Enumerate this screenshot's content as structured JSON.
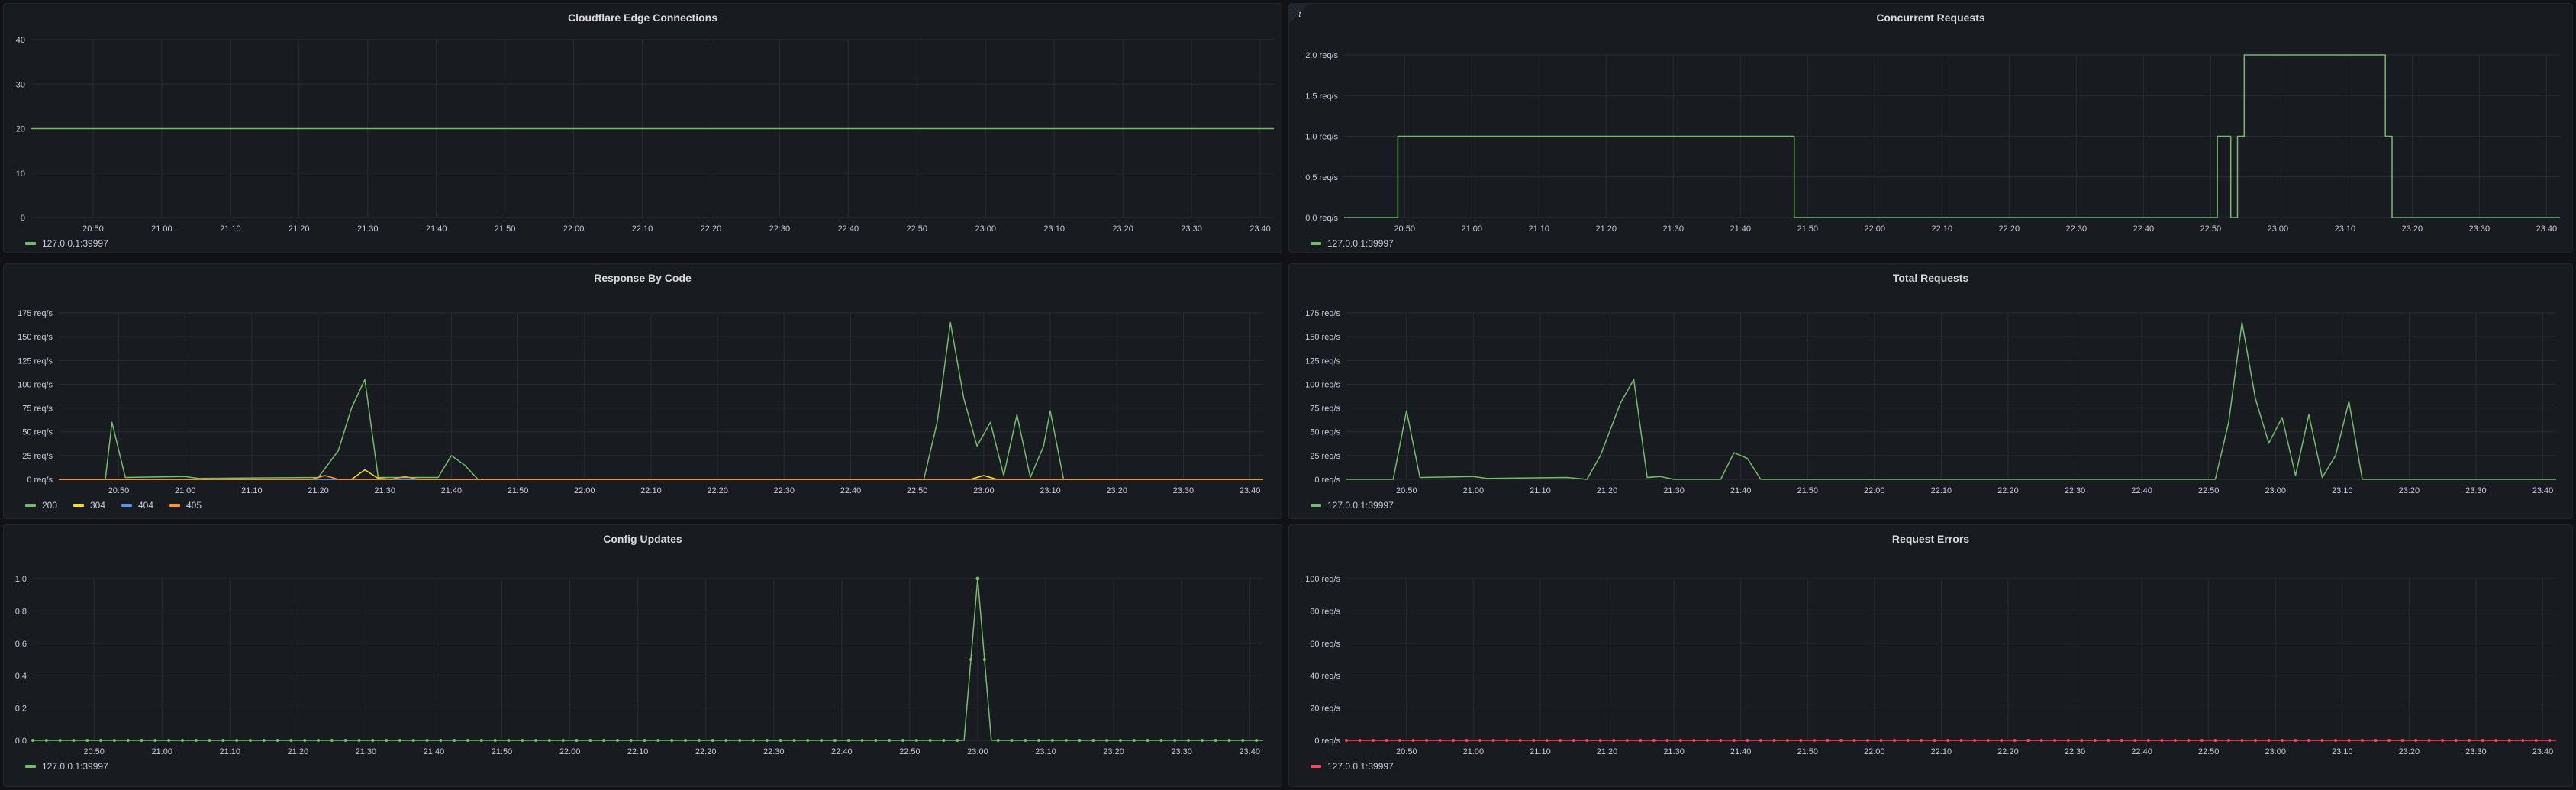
{
  "colors": {
    "green": "#73bf69",
    "yellow": "#fade2a",
    "blue": "#5794f2",
    "orange": "#ff9830",
    "red": "#f2495c"
  },
  "info_icon": "info-icon",
  "time_ticks": [
    "20:50",
    "21:00",
    "21:10",
    "21:20",
    "21:30",
    "21:40",
    "21:50",
    "22:00",
    "22:10",
    "22:20",
    "22:30",
    "22:40",
    "22:50",
    "23:00",
    "23:10",
    "23:20",
    "23:30",
    "23:40"
  ],
  "panels": [
    {
      "id": "cloudflare-edge-connections",
      "title": "Cloudflare Edge Connections",
      "y_ticks": [
        "0",
        "10",
        "20",
        "30",
        "40"
      ],
      "ylim": [
        0,
        40
      ],
      "legend": [
        {
          "label": "127.0.0.1:39997",
          "color": "#73bf69"
        }
      ]
    },
    {
      "id": "concurrent-requests",
      "title": "Concurrent Requests",
      "info": true,
      "y_ticks": [
        "0.0 req/s",
        "0.5 req/s",
        "1.0 req/s",
        "1.5 req/s",
        "2.0 req/s"
      ],
      "ylim": [
        0,
        2
      ],
      "legend": [
        {
          "label": "127.0.0.1:39997",
          "color": "#73bf69"
        }
      ]
    },
    {
      "id": "response-by-code",
      "title": "Response By Code",
      "y_ticks": [
        "0 req/s",
        "25 req/s",
        "50 req/s",
        "75 req/s",
        "100 req/s",
        "125 req/s",
        "150 req/s",
        "175 req/s"
      ],
      "ylim": [
        0,
        175
      ],
      "legend": [
        {
          "label": "200",
          "color": "#73bf69"
        },
        {
          "label": "304",
          "color": "#fade2a"
        },
        {
          "label": "404",
          "color": "#5794f2"
        },
        {
          "label": "405",
          "color": "#ff9830"
        }
      ]
    },
    {
      "id": "total-requests",
      "title": "Total Requests",
      "y_ticks": [
        "0 req/s",
        "25 req/s",
        "50 req/s",
        "75 req/s",
        "100 req/s",
        "125 req/s",
        "150 req/s",
        "175 req/s"
      ],
      "ylim": [
        0,
        175
      ],
      "legend": [
        {
          "label": "127.0.0.1:39997",
          "color": "#73bf69"
        }
      ]
    },
    {
      "id": "config-updates",
      "title": "Config Updates",
      "y_ticks": [
        "0.0",
        "0.2",
        "0.4",
        "0.6",
        "0.8",
        "1.0"
      ],
      "ylim": [
        0,
        1
      ],
      "legend": [
        {
          "label": "127.0.0.1:39997",
          "color": "#73bf69"
        }
      ]
    },
    {
      "id": "request-errors",
      "title": "Request Errors",
      "y_ticks": [
        "0 req/s",
        "20 req/s",
        "40 req/s",
        "60 req/s",
        "80 req/s",
        "100 req/s"
      ],
      "ylim": [
        0,
        100
      ],
      "legend": [
        {
          "label": "127.0.0.1:39997",
          "color": "#f2495c"
        }
      ]
    }
  ],
  "chart_data": [
    {
      "type": "line",
      "title": "Cloudflare Edge Connections",
      "x_range": [
        "20:41",
        "23:42"
      ],
      "ylim": [
        0,
        40
      ],
      "series": [
        {
          "name": "127.0.0.1:39997",
          "color": "#73bf69",
          "points": [
            [
              "20:41",
              20
            ],
            [
              "23:42",
              20
            ]
          ]
        }
      ]
    },
    {
      "type": "line",
      "title": "Concurrent Requests",
      "x_range": [
        "20:41",
        "23:42"
      ],
      "ylim": [
        0,
        2
      ],
      "series": [
        {
          "name": "127.0.0.1:39997",
          "color": "#73bf69",
          "points": [
            [
              "20:41",
              0
            ],
            [
              "20:49",
              0
            ],
            [
              "20:49",
              1
            ],
            [
              "21:48",
              1
            ],
            [
              "21:48",
              0
            ],
            [
              "22:51",
              0
            ],
            [
              "22:51",
              1
            ],
            [
              "22:53",
              1
            ],
            [
              "22:53",
              0
            ],
            [
              "22:54",
              0
            ],
            [
              "22:54",
              1
            ],
            [
              "22:55",
              1
            ],
            [
              "22:55",
              2
            ],
            [
              "23:16",
              2
            ],
            [
              "23:16",
              1
            ],
            [
              "23:17",
              1
            ],
            [
              "23:17",
              0
            ],
            [
              "23:42",
              0
            ]
          ]
        }
      ]
    },
    {
      "type": "line",
      "title": "Response By Code",
      "x_range": [
        "20:41",
        "23:42"
      ],
      "ylim": [
        0,
        175
      ],
      "series": [
        {
          "name": "200",
          "color": "#73bf69",
          "points": [
            [
              "20:41",
              0
            ],
            [
              "20:48",
              0
            ],
            [
              "20:49",
              60
            ],
            [
              "20:51",
              2
            ],
            [
              "21:00",
              3
            ],
            [
              "21:02",
              1
            ],
            [
              "21:20",
              2
            ],
            [
              "21:23",
              30
            ],
            [
              "21:25",
              75
            ],
            [
              "21:27",
              105
            ],
            [
              "21:29",
              2
            ],
            [
              "21:38",
              2
            ],
            [
              "21:40",
              25
            ],
            [
              "21:42",
              15
            ],
            [
              "21:44",
              0
            ],
            [
              "22:51",
              0
            ],
            [
              "22:53",
              60
            ],
            [
              "22:55",
              165
            ],
            [
              "22:57",
              85
            ],
            [
              "22:59",
              35
            ],
            [
              "23:01",
              60
            ],
            [
              "23:03",
              4
            ],
            [
              "23:05",
              68
            ],
            [
              "23:07",
              2
            ],
            [
              "23:09",
              35
            ],
            [
              "23:10",
              72
            ],
            [
              "23:12",
              0
            ],
            [
              "23:42",
              0
            ]
          ]
        },
        {
          "name": "304",
          "color": "#fade2a",
          "points": [
            [
              "20:41",
              0
            ],
            [
              "21:25",
              0
            ],
            [
              "21:27",
              10
            ],
            [
              "21:29",
              1
            ],
            [
              "21:31",
              0
            ],
            [
              "22:58",
              0
            ],
            [
              "23:00",
              4
            ],
            [
              "23:02",
              0
            ],
            [
              "23:42",
              0
            ]
          ]
        },
        {
          "name": "404",
          "color": "#5794f2",
          "points": [
            [
              "20:41",
              0
            ],
            [
              "23:42",
              0
            ]
          ]
        },
        {
          "name": "405",
          "color": "#ff9830",
          "points": [
            [
              "20:41",
              0
            ],
            [
              "21:19",
              0
            ],
            [
              "21:21",
              4
            ],
            [
              "21:23",
              0
            ],
            [
              "21:31",
              0
            ],
            [
              "21:33",
              3
            ],
            [
              "21:35",
              0
            ],
            [
              "23:42",
              0
            ]
          ]
        }
      ]
    },
    {
      "type": "line",
      "title": "Total Requests",
      "x_range": [
        "20:41",
        "23:42"
      ],
      "ylim": [
        0,
        175
      ],
      "series": [
        {
          "name": "127.0.0.1:39997",
          "color": "#73bf69",
          "points": [
            [
              "20:41",
              0
            ],
            [
              "20:48",
              0
            ],
            [
              "20:50",
              72
            ],
            [
              "20:52",
              2
            ],
            [
              "21:00",
              3
            ],
            [
              "21:02",
              1
            ],
            [
              "21:14",
              2
            ],
            [
              "21:17",
              0
            ],
            [
              "21:19",
              25
            ],
            [
              "21:22",
              80
            ],
            [
              "21:24",
              105
            ],
            [
              "21:26",
              2
            ],
            [
              "21:28",
              3
            ],
            [
              "21:30",
              0
            ],
            [
              "21:37",
              0
            ],
            [
              "21:39",
              28
            ],
            [
              "21:41",
              22
            ],
            [
              "21:43",
              0
            ],
            [
              "22:51",
              0
            ],
            [
              "22:53",
              60
            ],
            [
              "22:55",
              165
            ],
            [
              "22:57",
              85
            ],
            [
              "22:59",
              38
            ],
            [
              "23:01",
              65
            ],
            [
              "23:03",
              4
            ],
            [
              "23:05",
              68
            ],
            [
              "23:07",
              2
            ],
            [
              "23:09",
              25
            ],
            [
              "23:11",
              82
            ],
            [
              "23:13",
              0
            ],
            [
              "23:42",
              0
            ]
          ]
        }
      ]
    },
    {
      "type": "line",
      "title": "Config Updates",
      "x_range": [
        "20:41",
        "23:42"
      ],
      "ylim": [
        0,
        1
      ],
      "points_visible": true,
      "series": [
        {
          "name": "127.0.0.1:39997",
          "color": "#73bf69",
          "points": [
            [
              "20:41",
              0
            ],
            [
              "22:58",
              0
            ],
            [
              "23:00",
              1
            ],
            [
              "23:02",
              0
            ],
            [
              "23:42",
              0
            ]
          ]
        }
      ]
    },
    {
      "type": "line",
      "title": "Request Errors",
      "x_range": [
        "20:41",
        "23:42"
      ],
      "ylim": [
        0,
        100
      ],
      "points_visible": true,
      "series": [
        {
          "name": "127.0.0.1:39997",
          "color": "#f2495c",
          "points": [
            [
              "20:41",
              0
            ],
            [
              "23:42",
              0
            ]
          ]
        }
      ]
    }
  ]
}
